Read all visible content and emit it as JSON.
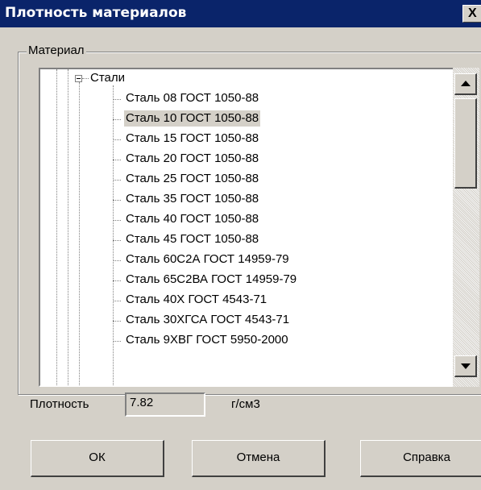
{
  "window": {
    "title": "Плотность материалов",
    "close_glyph": "X"
  },
  "group": {
    "label": "Материал"
  },
  "tree": {
    "parent": "Стали",
    "selected_index": 1,
    "items": [
      "Сталь 08  ГОСТ 1050-88",
      "Сталь 10  ГОСТ 1050-88",
      "Сталь 15  ГОСТ 1050-88",
      "Сталь 20  ГОСТ 1050-88",
      "Сталь 25  ГОСТ 1050-88",
      "Сталь 35  ГОСТ 1050-88",
      "Сталь 40  ГОСТ 1050-88",
      "Сталь 45  ГОСТ 1050-88",
      "Сталь 60С2А  ГОСТ 14959-79",
      "Сталь 65С2ВА  ГОСТ 14959-79",
      "Сталь 40Х  ГОСТ 4543-71",
      "Сталь 30ХГСА  ГОСТ 4543-71",
      "Сталь 9ХВГ  ГОСТ 5950-2000"
    ]
  },
  "density": {
    "label": "Плотность",
    "value": "7.82",
    "unit": "г/см3"
  },
  "buttons": {
    "ok": "ОК",
    "cancel": "Отмена",
    "help": "Справка"
  }
}
